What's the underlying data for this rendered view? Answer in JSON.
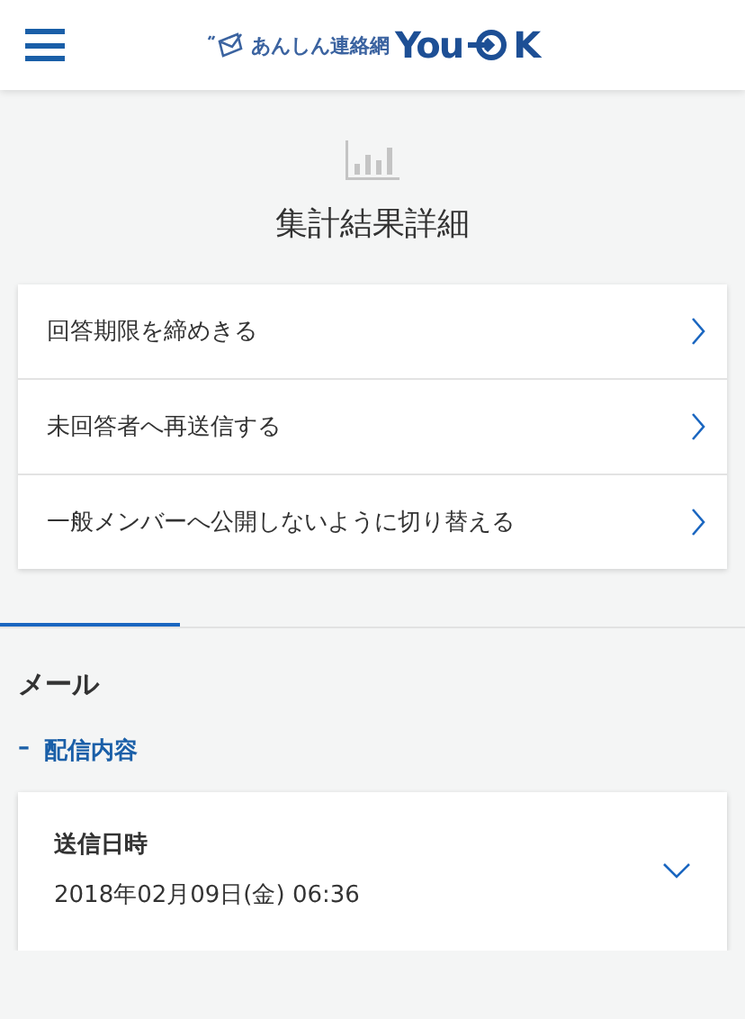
{
  "header": {
    "logo": {
      "tagline": "あんしん連絡網",
      "brand_start": "You",
      "brand_end": "K"
    }
  },
  "page_title": "集計結果詳細",
  "actions": [
    {
      "label": "回答期限を締めきる"
    },
    {
      "label": "未回答者へ再送信する"
    },
    {
      "label": "一般メンバーへ公開しないように切り替える"
    }
  ],
  "section": {
    "title": "メール",
    "group": {
      "marker": "–",
      "label": "配信内容",
      "expanded": true
    },
    "card": {
      "label": "送信日時",
      "value": "2018年02月09日(金) 06:36",
      "expanded": false
    }
  }
}
